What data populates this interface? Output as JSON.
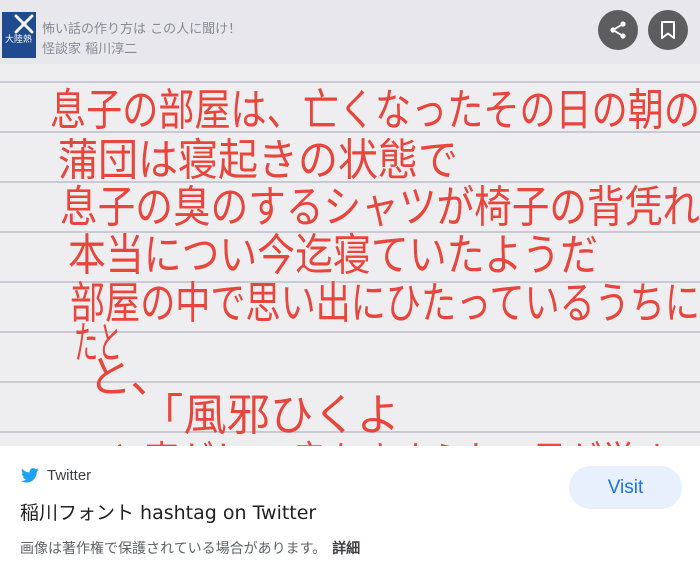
{
  "preview": {
    "alt": "稲川フォント手書きテロップの画像",
    "overlay_channel": "大陸熱",
    "overlay_line1": "怖い話の作り方は この人に聞け！",
    "overlay_line2": "怪談家 稲川淳二",
    "handwriting_lines": [
      "息子の部屋は、亡くなったその日の朝の",
      "蒲団は寝起きの状態で",
      "息子の臭のするシャツが椅子の背凭れ",
      "本当につい今迄寝ていたようだ",
      "部屋の中で思い出にひたっているうちに",
      "たと",
      "と、",
      "「風邪ひくよ",
      "と声がして 肩をゆすられて目が覚め"
    ],
    "colors": {
      "handwriting": "#e8463c",
      "paper": "#efeff2",
      "rule": "#c9c9d3"
    }
  },
  "controls": {
    "close_icon": "close-icon",
    "share_icon": "share-icon",
    "bookmark_icon": "bookmark-icon"
  },
  "source": {
    "icon": "twitter-bird-icon",
    "name": "Twitter",
    "color": "#1da1f2"
  },
  "title": "稲川フォント hashtag on Twitter",
  "copyright": {
    "text": "画像は著作権で保護されている場合があります。",
    "link": "詳細"
  },
  "visit_label": "Visit"
}
